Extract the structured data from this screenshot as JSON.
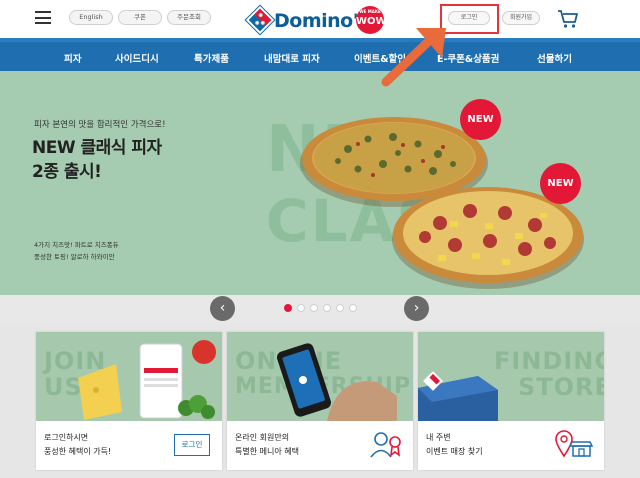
{
  "header": {
    "lang_label": "English",
    "coupon_label": "쿠폰",
    "order_lookup_label": "주문조회",
    "brand": "Domino's",
    "brand_badge_top": "WE MAKE",
    "brand_badge": "WOW",
    "login_label": "로그인",
    "signup_label": "회원가입"
  },
  "nav": {
    "items": [
      "피자",
      "사이드디시",
      "특가제품",
      "내맘대로 피자",
      "이벤트&할인",
      "E-쿠폰&상품권",
      "선물하기"
    ]
  },
  "hero": {
    "subtitle": "피자 본연의 맛을 합리적인 가격으로!",
    "title_line1": "NEW 클래식 피자",
    "title_line2": "2종 출시!",
    "note_line1": "4가지 치즈맛! 파트로 치즈퐁듀",
    "note_line2": "풍성한 토핑! 알로하 하와이안",
    "big_word1": "NE",
    "big_word2": "CLASS",
    "badge1": "NEW",
    "badge2": "NEW"
  },
  "slider": {
    "prev_glyph": "‹",
    "next_glyph": "›",
    "dot_count": 6,
    "active_index": 0
  },
  "cards": [
    {
      "img_text_line1": "JOIN",
      "img_text_line2": "US",
      "line1": "로그인하시면",
      "line2": "풍성한 혜택이 가득!",
      "button": "로그인",
      "icon": "none"
    },
    {
      "img_text_line1": "ONLINE",
      "img_text_line2": "MEMBERSHIP",
      "line1": "온라인 회원만의",
      "line2": "특별한 메니아 혜택",
      "icon": "membership-icon"
    },
    {
      "img_text_line1": "FINDING",
      "img_text_line2": "STORE",
      "line1": "내 주변",
      "line2": "이벤트 매장 찾기",
      "icon": "store-location-icon"
    }
  ],
  "colors": {
    "brand_blue": "#1f6fb0",
    "brand_red": "#e31837",
    "hero_bg": "#a5ccb0",
    "highlight": "#e5333c",
    "annotation_arrow": "#e96a3a"
  }
}
